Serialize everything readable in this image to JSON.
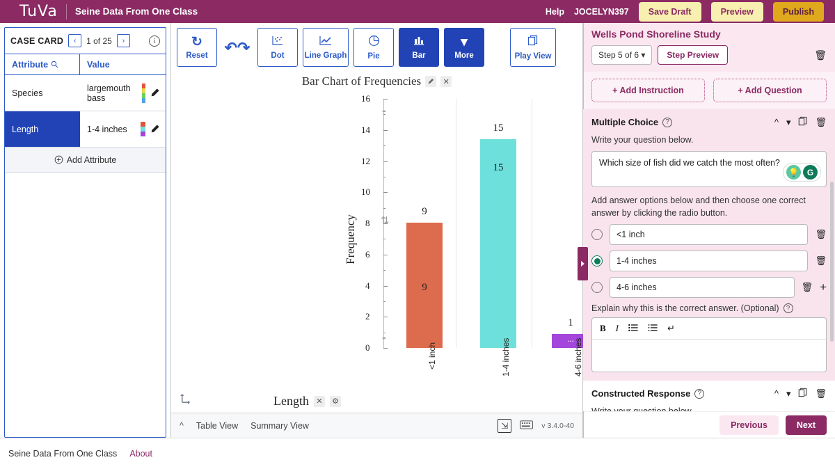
{
  "header": {
    "logo": "TuVa",
    "project_title": "Seine Data From One Class",
    "help": "Help",
    "user": "JOCELYN397",
    "save_draft": "Save Draft",
    "preview": "Preview",
    "publish": "Publish"
  },
  "case_card": {
    "title": "CASE CARD",
    "prev": "‹",
    "next": "›",
    "count": "1 of 25",
    "info_icon": "info-icon",
    "col_attribute": "Attribute",
    "col_value": "Value",
    "add_attribute": "Add Attribute",
    "rows": [
      {
        "attribute": "Species",
        "value": "largemouth bass",
        "selected": false,
        "swatch": [
          "#E0563D",
          "#E8D84A",
          "#6FCF5F",
          "#4FA6E8"
        ]
      },
      {
        "attribute": "Length",
        "value": "1-4 inches",
        "selected": true,
        "swatch": [
          "#E0563D",
          "#6EE0DC",
          "#A445DB"
        ]
      }
    ]
  },
  "toolbar": {
    "items": [
      {
        "label": "Reset",
        "icon": "reset-icon",
        "active": false
      },
      {
        "label": "",
        "icon": "undo-redo-icon",
        "active": false
      },
      {
        "label": "Dot",
        "icon": "dot-plot-icon",
        "active": false
      },
      {
        "label": "Line Graph",
        "icon": "line-graph-icon",
        "active": false
      },
      {
        "label": "Pie",
        "icon": "pie-chart-icon",
        "active": false
      },
      {
        "label": "Bar",
        "icon": "bar-chart-icon",
        "active": true
      },
      {
        "label": "More",
        "icon": "chevron-down-icon",
        "active": true
      }
    ],
    "play_view": "Play View",
    "play_view_icon": "copy-stack-icon"
  },
  "chart_data": {
    "type": "bar",
    "title": "Bar Chart of Frequencies",
    "xlabel": "Length",
    "ylabel": "Frequency",
    "categories": [
      "<1 inch",
      "1-4 inches",
      "4-6 inches"
    ],
    "values": [
      9,
      15,
      1
    ],
    "bar_colors": [
      "#DD6B4D",
      "#6EE0DC",
      "#A445DB"
    ],
    "ylim": [
      0,
      16
    ],
    "yticks": [
      0,
      2,
      4,
      6,
      8,
      10,
      12,
      14,
      16
    ],
    "grid": false,
    "legend": {
      "title": "Length",
      "position": "right",
      "entries": [
        {
          "label": "<1 inch",
          "color": "#DD6B4D"
        },
        {
          "label": "1-4 inches",
          "color": "#6EE0DC"
        },
        {
          "label": "4-6 inches",
          "color": "#A445DB"
        }
      ]
    },
    "in_bar_labels": [
      "9",
      "15",
      "..."
    ],
    "top_labels": [
      "9",
      "15",
      "1"
    ]
  },
  "chart_controls": {
    "edit_title_icon": "pencil-icon",
    "remove_title_icon": "close-icon",
    "legend_close_icon": "close-icon",
    "xaxis_close_icon": "close-icon",
    "xaxis_gear_icon": "gear-icon",
    "axis_swap_icon": "axis-swap-icon"
  },
  "status_bar": {
    "collapse_icon": "chevron-up-icon",
    "table_view": "Table View",
    "summary_view": "Summary View",
    "expand_icon": "expand-icon",
    "keyboard_icon": "keyboard-icon",
    "version": "v 3.4.0-40"
  },
  "right_panel": {
    "study_title": "Wells Pond Shoreline Study",
    "step_select": "Step 5 of 6",
    "step_preview": "Step Preview",
    "delete_icon": "trash-icon",
    "add_instruction": "+ Add Instruction",
    "add_question": "+ Add Question",
    "multiple_choice": {
      "title": "Multiple Choice",
      "help_icon": "question-mark-icon",
      "move_up_icon": "chevron-up-icon",
      "move_down_icon": "chevron-down-icon",
      "duplicate_icon": "copy-icon",
      "delete_icon": "trash-icon",
      "prompt": "Write your question below.",
      "question_text": "Which size of fish did we catch the most often?",
      "ai_hint_icon": "lightbulb-icon",
      "ai_grammar_icon": "grammarly-icon",
      "options_hint": "Add answer options below and then choose one correct answer by clicking the radio button.",
      "options": [
        {
          "text": "<1 inch",
          "correct": false
        },
        {
          "text": "1-4 inches",
          "correct": true
        },
        {
          "text": "4-6 inches",
          "correct": false
        }
      ],
      "add_option_icon": "plus-icon",
      "explain_label": "Explain why this is the correct answer. (Optional)",
      "explain_help_icon": "question-mark-icon",
      "rt_bold": "B",
      "rt_italic": "I",
      "rt_bullets_icon": "bulleted-list-icon",
      "rt_numbered_icon": "numbered-list-icon",
      "rt_return_icon": "line-break-icon",
      "explain_value": ""
    },
    "constructed_response": {
      "title": "Constructed Response",
      "help_icon": "question-mark-icon",
      "move_up_icon": "chevron-up-icon",
      "move_down_icon": "chevron-down-icon",
      "duplicate_icon": "copy-icon",
      "delete_icon": "trash-icon",
      "prompt": "Write your question below."
    },
    "previous": "Previous",
    "next": "Next"
  },
  "footer": {
    "dataset": "Seine Data From One Class",
    "about": "About"
  }
}
